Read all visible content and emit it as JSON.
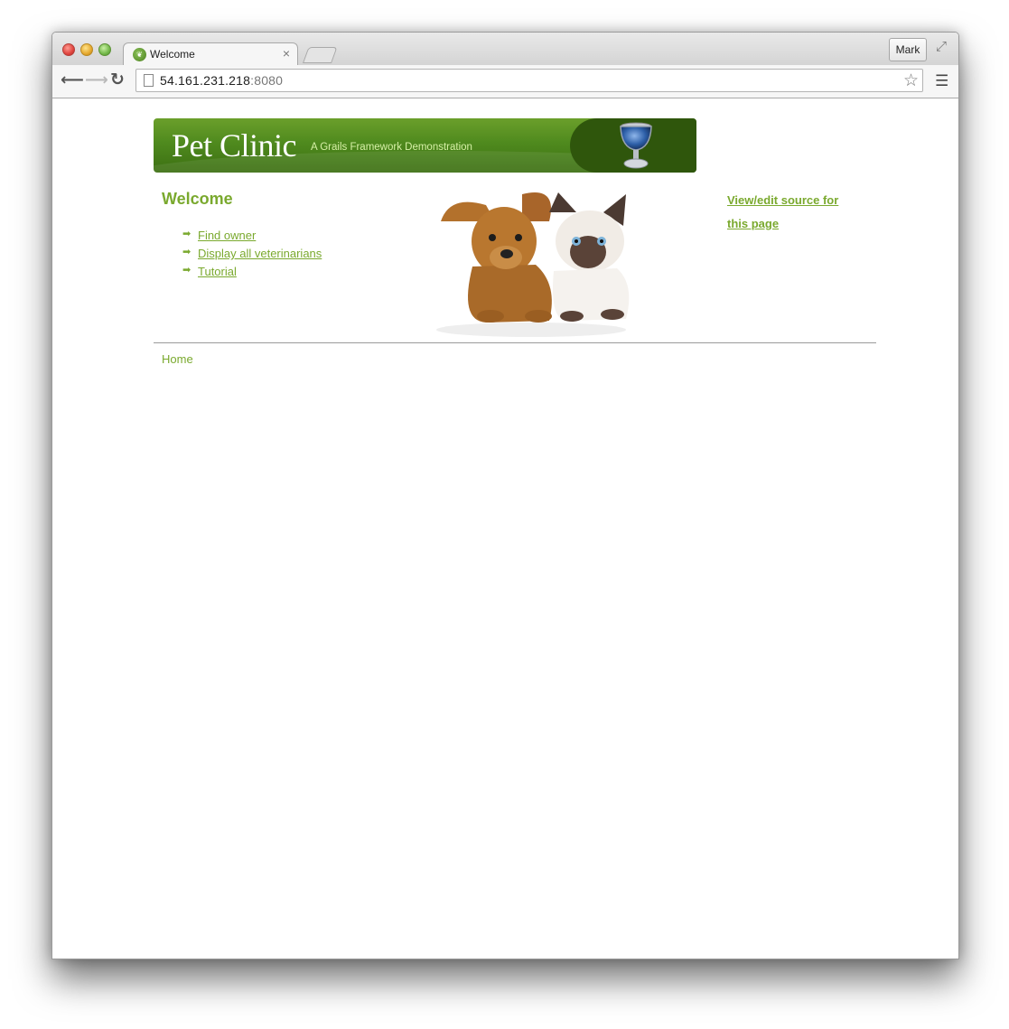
{
  "browser": {
    "tab_title": "Welcome",
    "tab_close": "×",
    "profile_name": "Mark",
    "url_host": "54.161.231.218",
    "url_port": ":8080"
  },
  "icons": {
    "back": "arrow-left-icon",
    "forward": "arrow-right-icon",
    "reload": "reload-icon",
    "bookmark": "star-icon",
    "menu": "hamburger-menu-icon",
    "fullscreen": "fullscreen-icon",
    "favicon": "grails-favicon",
    "list_bullet": "arrow-bullet-icon"
  },
  "banner": {
    "title": "Pet Clinic",
    "subtitle": "A  Grails Framework Demonstration"
  },
  "main": {
    "heading": "Welcome",
    "links": [
      {
        "label": "Find owner"
      },
      {
        "label": "Display all veterinarians"
      },
      {
        "label": "Tutorial"
      }
    ],
    "source_link": "View/edit source for this page"
  },
  "footer": {
    "breadcrumb_home": "Home"
  },
  "colors": {
    "accent_green": "#7aa92e",
    "banner_green": "#4f8a1e",
    "banner_dark": "#2f560c"
  }
}
